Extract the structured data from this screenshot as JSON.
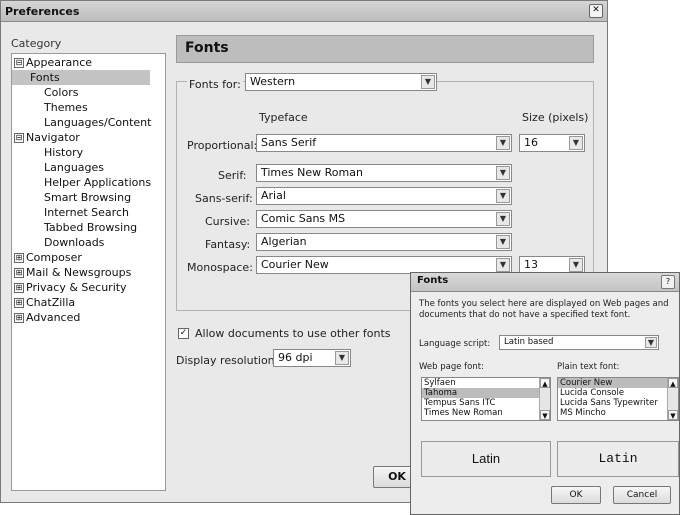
{
  "window": {
    "title": "Preferences"
  },
  "category": {
    "label": "Category",
    "items": [
      {
        "label": "Appearance",
        "toggle": "⊟"
      },
      {
        "label": "Fonts"
      },
      {
        "label": "Colors"
      },
      {
        "label": "Themes"
      },
      {
        "label": "Languages/Content"
      },
      {
        "label": "Navigator",
        "toggle": "⊟"
      },
      {
        "label": "History"
      },
      {
        "label": "Languages"
      },
      {
        "label": "Helper Applications"
      },
      {
        "label": "Smart Browsing"
      },
      {
        "label": "Internet Search"
      },
      {
        "label": "Tabbed Browsing"
      },
      {
        "label": "Downloads"
      },
      {
        "label": "Composer",
        "toggle": "⊞"
      },
      {
        "label": "Mail & Newsgroups",
        "toggle": "⊞"
      },
      {
        "label": "Privacy & Security",
        "toggle": "⊞"
      },
      {
        "label": "ChatZilla",
        "toggle": "⊞"
      },
      {
        "label": "Advanced",
        "toggle": "⊞"
      }
    ]
  },
  "panel": {
    "title": "Fonts",
    "fonts_for_label": "Fonts for:",
    "fonts_for_value": "Western",
    "typeface_header": "Typeface",
    "size_header": "Size (pixels)",
    "proportional": {
      "label": "Proportional:",
      "value": "Sans Serif",
      "size": "16"
    },
    "serif": {
      "label": "Serif:",
      "value": "Times New Roman"
    },
    "sans_serif": {
      "label": "Sans-serif:",
      "value": "Arial"
    },
    "cursive": {
      "label": "Cursive:",
      "value": "Comic Sans MS"
    },
    "fantasy": {
      "label": "Fantasy:",
      "value": "Algerian"
    },
    "monospace": {
      "label": "Monospace:",
      "value": "Courier New",
      "size": "13"
    },
    "allow_docs_label": "Allow documents to use other fonts",
    "allow_docs_checked": "✓",
    "display_resolution_label": "Display resolution:",
    "display_resolution_value": "96 dpi",
    "ok_label": "OK"
  },
  "fonts_dialog": {
    "title": "Fonts",
    "help": "?",
    "description": "The fonts you select here are displayed on Web pages and documents that do not have a specified text font.",
    "language_script_label": "Language script:",
    "language_script_value": "Latin based",
    "web_font_label": "Web page font:",
    "plain_font_label": "Plain text font:",
    "web_fonts": [
      "Sylfaen",
      "Tahoma",
      "Tempus Sans ITC",
      "Times New Roman"
    ],
    "plain_fonts": [
      "Courier New",
      "Lucida Console",
      "Lucida Sans Typewriter",
      "MS Mincho"
    ],
    "preview_web": "Latin",
    "preview_plain": "Latin",
    "ok_label": "OK",
    "cancel_label": "Cancel"
  }
}
